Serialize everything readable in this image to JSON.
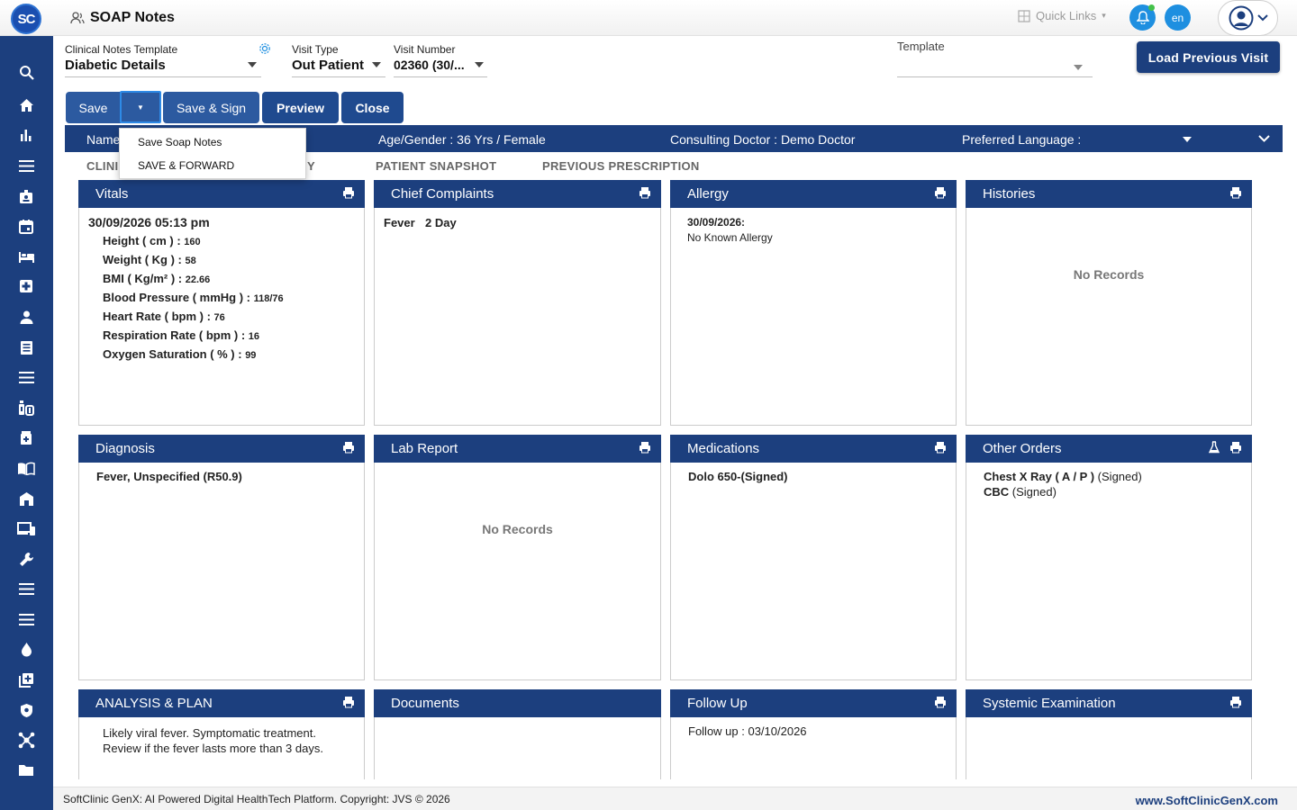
{
  "app": {
    "logo_text": "SC",
    "page_title": "SOAP Notes"
  },
  "topbar": {
    "quick_links": "Quick Links",
    "lang": "en"
  },
  "fields": {
    "template_label": "Clinical Notes Template",
    "template_value": "Diabetic Details",
    "visit_type_label": "Visit Type",
    "visit_type_value": "Out Patient",
    "visit_number_label": "Visit Number",
    "visit_number_value": "02360 (30/...",
    "template2_label": "Template",
    "template2_value": ""
  },
  "buttons": {
    "load_previous": "Load Previous Visit",
    "save": "Save",
    "save_sign": "Save & Sign",
    "preview": "Preview",
    "close": "Close"
  },
  "save_menu": [
    "Save Soap Notes",
    "SAVE & FORWARD"
  ],
  "patient": {
    "name_label": "Name",
    "age_gender": "Age/Gender :  36 Yrs / Female",
    "doctor": "Consulting Doctor :  Demo Doctor",
    "language": "Preferred Language :"
  },
  "tabs": {
    "clinical": "CLINI",
    "history_tail": "Y",
    "snapshot": "PATIENT SNAPSHOT",
    "prescription": "PREVIOUS PRESCRIPTION"
  },
  "cards": {
    "vitals": {
      "title": "Vitals",
      "date": "30/09/2026 05:13 pm",
      "items": [
        {
          "label": "Height ( cm ) : ",
          "value": "160"
        },
        {
          "label": "Weight ( Kg ) : ",
          "value": "58"
        },
        {
          "label": "BMI ( Kg/m² ) : ",
          "value": "22.66"
        },
        {
          "label": "Blood Pressure ( mmHg ) : ",
          "value": "118/76"
        },
        {
          "label": "Heart Rate ( bpm ) : ",
          "value": "76"
        },
        {
          "label": "Respiration Rate ( bpm ) : ",
          "value": "16"
        },
        {
          "label": "Oxygen Saturation ( % ) : ",
          "value": "99"
        }
      ]
    },
    "chief": {
      "title": "Chief Complaints",
      "complaint": "Fever",
      "duration": "2 Day"
    },
    "allergy": {
      "title": "Allergy",
      "date": "30/09/2026:",
      "text": "No Known Allergy"
    },
    "histories": {
      "title": "Histories",
      "empty": "No Records"
    },
    "diagnosis": {
      "title": "Diagnosis",
      "text": "Fever, Unspecified (R50.9)"
    },
    "lab": {
      "title": "Lab Report",
      "empty": "No Records"
    },
    "medications": {
      "title": "Medications",
      "text": "Dolo 650-(Signed)"
    },
    "other_orders": {
      "title": "Other Orders",
      "items": [
        {
          "name": "Chest X Ray ( A / P )",
          "status": " (Signed)"
        },
        {
          "name": "CBC",
          "status": " (Signed)"
        }
      ]
    },
    "analysis": {
      "title": "ANALYSIS & PLAN",
      "line1": "Likely viral fever. Symptomatic treatment.",
      "line2": "Review if the fever lasts more than 3 days."
    },
    "documents": {
      "title": "Documents"
    },
    "followup": {
      "title": "Follow Up",
      "text": "Follow up : 03/10/2026"
    },
    "systemic": {
      "title": "Systemic Examination"
    }
  },
  "footer": {
    "left": "SoftClinic GenX: AI Powered Digital HealthTech Platform. Copyright: JVS © 2026",
    "right": "www.SoftClinicGenX.com"
  },
  "sidebar_icons": [
    "search-icon",
    "home-icon",
    "bar-chart-icon",
    "menu-icon",
    "id-badge-icon",
    "calendar-icon",
    "bed-icon",
    "medical-plus-icon",
    "user-icon",
    "document-list-icon",
    "menu-icon",
    "pharmacy-icon",
    "medicine-box-icon",
    "book-icon",
    "ward-icon",
    "devices-icon",
    "wrench-icon",
    "menu-icon",
    "menu-icon",
    "blood-drop-icon",
    "add-box-icon",
    "shield-icon",
    "network-icon",
    "folder-icon"
  ],
  "colors": {
    "primary": "#1c3f7e",
    "accent": "#1e8fe0",
    "button": "#2c5aa0"
  }
}
